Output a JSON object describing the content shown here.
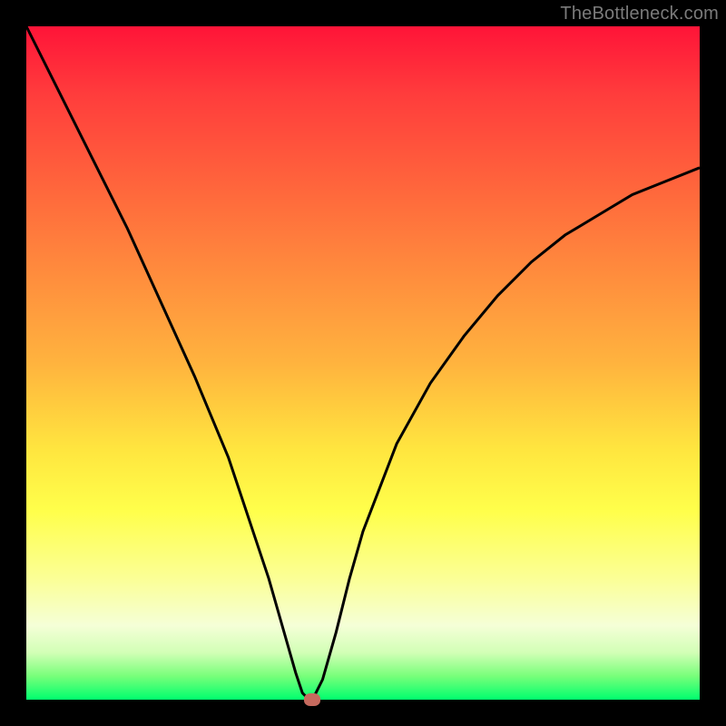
{
  "watermark": "TheBottleneck.com",
  "colors": {
    "frame": "#000000",
    "curve_stroke": "#000000",
    "marker_fill": "#c66a5e",
    "gradient_top": "#ff1438",
    "gradient_bottom": "#00ff6e"
  },
  "chart_data": {
    "type": "line",
    "title": "",
    "xlabel": "",
    "ylabel": "",
    "xlim": [
      0,
      100
    ],
    "ylim": [
      0,
      100
    ],
    "grid": false,
    "legend": false,
    "series": [
      {
        "name": "bottleneck-curve",
        "x": [
          0,
          5,
          10,
          15,
          20,
          25,
          30,
          32,
          34,
          36,
          38,
          40,
          41,
          42,
          42.5,
          44,
          46,
          48,
          50,
          55,
          60,
          65,
          70,
          75,
          80,
          85,
          90,
          95,
          100
        ],
        "values": [
          100,
          90,
          80,
          70,
          59,
          48,
          36,
          30,
          24,
          18,
          11,
          4,
          1,
          0,
          0,
          3,
          10,
          18,
          25,
          38,
          47,
          54,
          60,
          65,
          69,
          72,
          75,
          77,
          79
        ]
      }
    ],
    "marker": {
      "x": 42.5,
      "y": 0
    }
  }
}
